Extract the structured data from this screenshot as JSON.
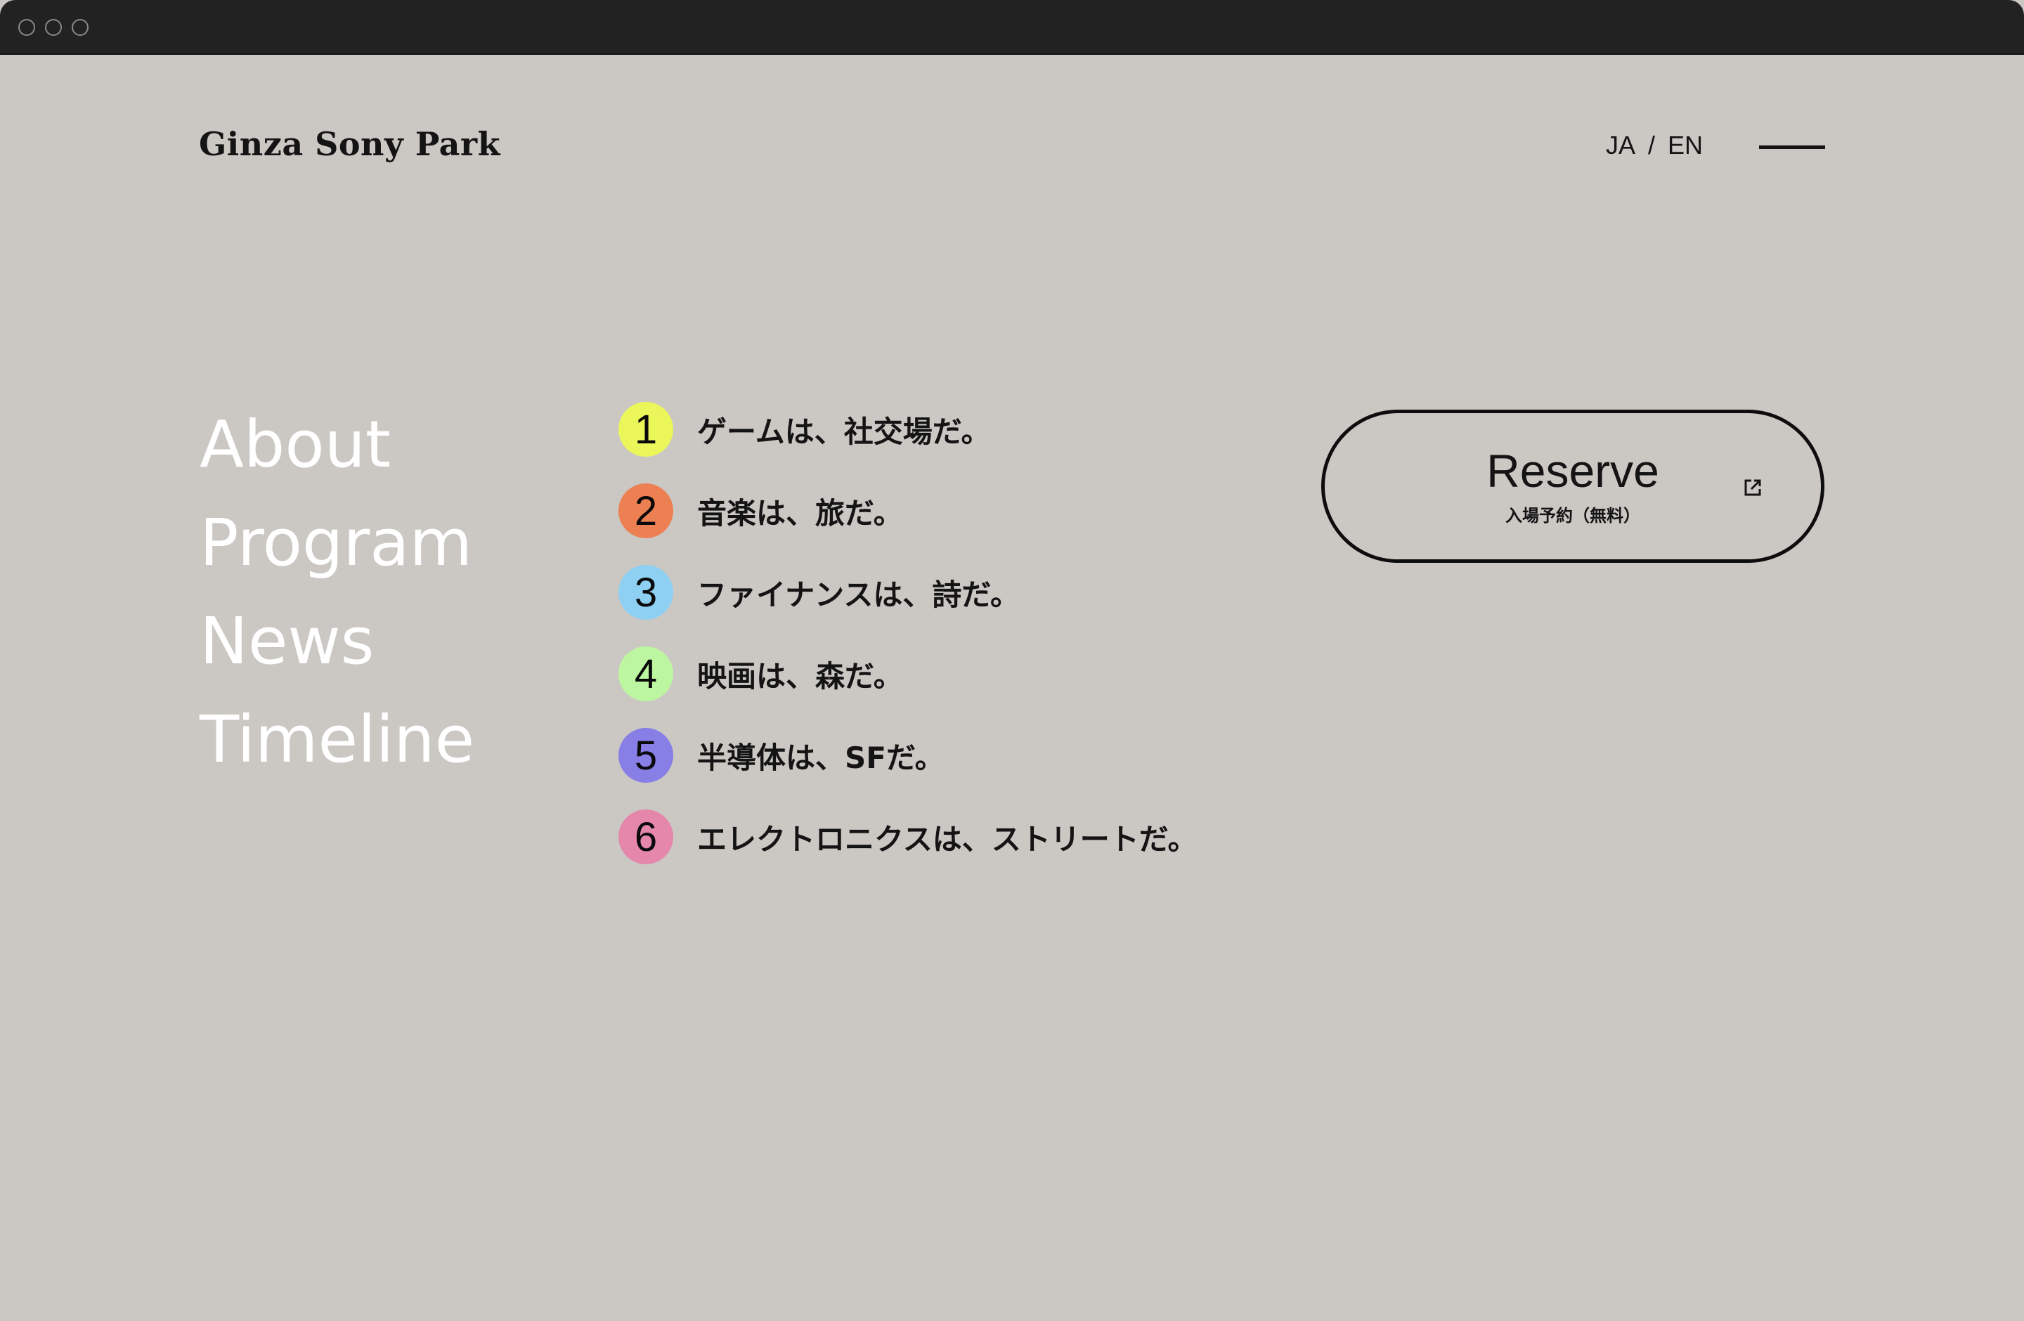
{
  "brand": {
    "name": "Ginza Sony Park"
  },
  "header": {
    "lang_ja": "JA",
    "lang_sep": "/",
    "lang_en": "EN",
    "menu_icon": "hamburger-line-icon"
  },
  "nav": {
    "items": [
      {
        "label": "About"
      },
      {
        "label": "Program"
      },
      {
        "label": "News"
      },
      {
        "label": "Timeline"
      }
    ]
  },
  "themes": [
    {
      "num": "1",
      "text": "ゲームは、社交場だ。",
      "color": "#eaf65a"
    },
    {
      "num": "2",
      "text": "音楽は、旅だ。",
      "color": "#ec8052"
    },
    {
      "num": "3",
      "text": "ファイナンスは、詩だ。",
      "color": "#8ed0f2"
    },
    {
      "num": "4",
      "text": "映画は、森だ。",
      "color": "#bdf6a0"
    },
    {
      "num": "5",
      "text": "半導体は、SFだ。",
      "color": "#877ee6"
    },
    {
      "num": "6",
      "text": "エレクトロニクスは、ストリートだ。",
      "color": "#e487ab"
    }
  ],
  "reserve": {
    "label": "Reserve",
    "sub": "入場予約（無料）",
    "icon": "external-link-icon"
  },
  "colors": {
    "background": "#cbc8c4",
    "titlebar": "#222222",
    "text": "#141414",
    "nav_text": "#ffffff"
  }
}
